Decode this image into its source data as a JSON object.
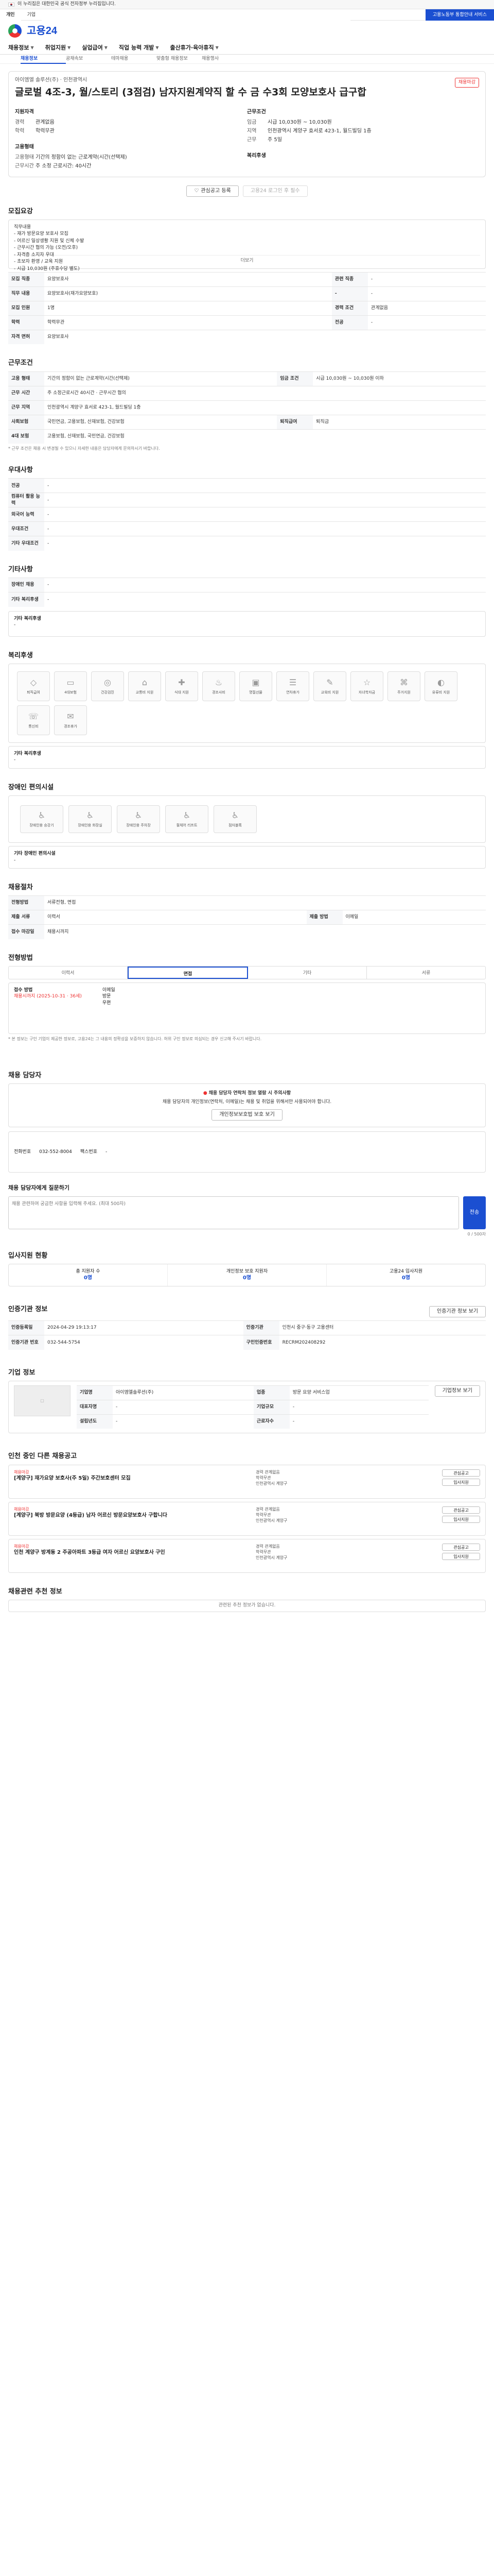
{
  "gov_bar": {
    "text": "이 누리집은 대한민국 공식 전자정부 누리집입니다."
  },
  "util": {
    "tabs": [
      "개인",
      "기업"
    ],
    "blue": "고용노동부 통합안내 서비스"
  },
  "header": {
    "logo": "고용24"
  },
  "gnb": [
    "채용정보",
    "취업지원",
    "실업급여",
    "직업 능력 개발",
    "출산휴가·육아휴직"
  ],
  "subnav": [
    "채용정보",
    "공채속보",
    "테마채용",
    "맞춤형 채용정보",
    "채용행사"
  ],
  "job": {
    "company": "아이엠엘 솔루션(주) · 인천광역시",
    "title": "글로벌 4조-3, 월/스토리 (3점검) 남자지원계약직 할 수 금 수3회 모양보호사 급구합",
    "status": "채용마감",
    "qual_h": "지원자격",
    "qual": [
      [
        "경력",
        "관계없음"
      ],
      [
        "학력",
        "학력무관"
      ]
    ],
    "cond_h": "근무조건",
    "cond": [
      [
        "임금",
        "시급 10,030원 ~ 10,030원"
      ],
      [
        "지역",
        "인천광역시 계양구 효서로 423-1, 월드빌딩 1층"
      ],
      [
        "근무",
        "주 5일"
      ]
    ],
    "type_h": "고용형태",
    "types": [
      [
        "고용형태",
        "기간의 정함이 없는 근로계약(시간(선택제)"
      ],
      [
        "근무시간",
        "주 소정 근로시간: 40시간"
      ]
    ],
    "welfare_h": "복리후생",
    "btn_scrap": "관심공고 등록",
    "btn_share": "고용24 로그인 후 필수"
  },
  "detail": {
    "title": "모집요강",
    "text": "직무내용\n- 재가 방문요양 보호사 모집\n- 어르신 일상생활 지원 및 신체 수발\n- 근무시간 협의 가능 (오전/오후)\n- 자격증 소지자 우대\n- 초보자 환영 / 교육 지원\n- 시급 10,030원 (주휴수당 별도)",
    "more": "더보기"
  },
  "recruit": {
    "rows": [
      [
        "모집 직종",
        "요양보호사",
        "관련 직종",
        "-"
      ],
      [
        "직무 내용",
        "요양보호사(재가요양보호)",
        "-",
        "-"
      ],
      [
        "모집 인원",
        "1명",
        "경력 조건",
        "관계없음"
      ],
      [
        "학력",
        "학력무관",
        "전공",
        "-"
      ],
      [
        "자격 면허",
        "요양보호사",
        "",
        ""
      ]
    ]
  },
  "work": {
    "rows": [
      [
        "고용 형태",
        "기간의 정함이 없는 근로계약(시간(선택제)",
        "임금 조건",
        "시급 10,030원 ~ 10,030원 이하"
      ],
      [
        "근무 시간",
        "주 소정근로시간 40시간 · 근무시간 협의",
        "",
        ""
      ],
      [
        "근무 지역",
        "인천광역시 계양구 효서로 423-1, 월드빌딩 1층",
        "",
        ""
      ],
      [
        "사회보험",
        "국민연금, 고용보험, 산재보험, 건강보험",
        "퇴직급여",
        "퇴직금"
      ],
      [
        "4대 보험",
        "고용보험, 산재보험, 국민연금, 건강보험",
        "",
        ""
      ]
    ],
    "note": "* 근무 조건은 채용 시 변경될 수 있으니 자세한 내용은 담당자에게 문의하시기 바랍니다."
  },
  "pref": {
    "title": "우대사항",
    "rows": [
      [
        "전공",
        "-"
      ],
      [
        "컴퓨터 활용 능력",
        "-"
      ],
      [
        "외국어 능력",
        "-"
      ],
      [
        "우대조건",
        "-"
      ],
      [
        "기타 우대조건",
        "-"
      ]
    ]
  },
  "dorm": {
    "title": "기타사항",
    "rows": [
      [
        "장애인 채용",
        "-"
      ],
      [
        "기타 복리후생",
        "-"
      ]
    ]
  },
  "welfare": {
    "title": "복리후생",
    "items": [
      "퇴직급여",
      "4대보험",
      "건강검진",
      "교통비 지원",
      "식대 지원",
      "경조사비",
      "명절선물",
      "연차휴가",
      "교육비 지원",
      "자녀학자금",
      "주거지원",
      "유류비 지원",
      "통신비",
      "경조휴가"
    ],
    "etc_h": "기타 복리후생",
    "etc_v": "-"
  },
  "disability": {
    "title": "장애인 편의시설",
    "items": [
      "장애인용 승강기",
      "장애인용 화장실",
      "장애인용 주차장",
      "휠체어 리프트",
      "점자블록"
    ],
    "etc_h": "기타 장애인 편의시설",
    "etc_v": "-"
  },
  "process": {
    "title": "채용절차",
    "rows": [
      [
        "전형방법",
        "서류전형, 면접",
        "",
        ""
      ],
      [
        "제출 서류",
        "이력서",
        "제출 방법",
        "이메일"
      ],
      [
        "접수 마감일",
        "채용시까지",
        "",
        ""
      ]
    ]
  },
  "method": {
    "title": "전형방법",
    "tabs": [
      "이력서",
      "면접",
      "기타",
      "서류"
    ],
    "contact": "접수 방법",
    "contact_v": "채용시까지 (2025-10-31 · 36세)",
    "fields": [
      "이메일",
      "방문",
      "우편"
    ]
  },
  "notice": "* 본 정보는 구인 기업이 제공한 정보로, 고용24는 그 내용의 정확성을 보증하지 않습니다. 허위 구인 정보로 의심되는 경우 신고해 주시기 바랍니다.",
  "manager": {
    "title": "채용 담당자",
    "warn_h": "채용 담당자 연락처 정보 열람 시 주의사항",
    "warn": "채용 담당자의 개인정보(연락처, 이메일)는 채용 및 취업을 위해서만 사용되어야 합니다.",
    "btn": "개인정보보호법 보호 보기",
    "tel_k": "전화번호",
    "tel": "032-552-8004",
    "fax_k": "팩스번호",
    "fax": "-"
  },
  "question": {
    "title": "채용 담당자에게 질문하기",
    "placeholder": "채용 관련하여 궁금한 사항을 입력해 주세요. (최대 500자)",
    "send": "전송",
    "count": "0 / 500자"
  },
  "apply": {
    "title": "입사지원 현황",
    "cols": [
      [
        "총 지원자 수",
        "0명"
      ],
      [
        "개인정보 보호 지원자",
        "0명"
      ],
      [
        "고용24 입사지원",
        "0명"
      ]
    ]
  },
  "corp": {
    "title": "기업 정보",
    "rows": [
      [
        "기업명",
        "아이엠엘솔루션(주)",
        "업종",
        "방문 요양 서비스업"
      ],
      [
        "대표자명",
        "-",
        "기업규모",
        "-"
      ],
      [
        "설립년도",
        "-",
        "근로자수",
        "-"
      ]
    ],
    "btn": "기업정보 보기"
  },
  "company_more": {
    "title": "인증기관 정보",
    "rows": [
      [
        "인증등록일",
        "2024-04-29 19:13:17",
        "인증기관",
        "인천시 중구·동구 고용센터"
      ],
      [
        "인증기관 번호",
        "032-544-5754",
        "구인인증번호",
        "RECRM202408292"
      ]
    ],
    "btn": "인증기관 정보 보기"
  },
  "related": {
    "title": "인천 중인 다른 채용공고",
    "items": [
      {
        "co": "채용마감",
        "title": "[계양구] 재가요양 보호사(주 5일) 주간보호센터 모집",
        "d1": "경력 관계없음",
        "d2": "학력무관",
        "d3": "인천광역시 계양구"
      },
      {
        "co": "채용마감",
        "title": "[계양구] 북방 방문요양 (4등급) 남자 어르신 방문요양보호사 구합니다",
        "d1": "경력 관계없음",
        "d2": "학력무관",
        "d3": "인천광역시 계양구"
      },
      {
        "co": "채용마감",
        "title": "인천 계양구 방계동 2 주공아파트 3등급 여자 어르신 요양보호사 구인",
        "d1": "경력 관계없음",
        "d2": "학력무관",
        "d3": "인천광역시 계양구"
      }
    ],
    "btn1": "관심공고",
    "btn2": "입사지원"
  },
  "footer": {
    "title": "채용관련 추천 정보",
    "text": "관련된 추천 정보가 없습니다."
  }
}
